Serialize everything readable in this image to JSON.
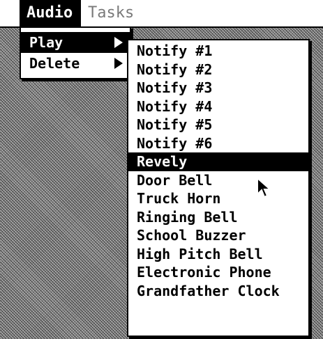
{
  "menubar": {
    "items": [
      {
        "label": "Audio",
        "state": "open"
      },
      {
        "label": "Tasks",
        "state": "inactive"
      }
    ]
  },
  "audio_menu": {
    "items": [
      {
        "label": "Play",
        "submenu": true,
        "selected": true
      },
      {
        "label": "Delete",
        "submenu": true,
        "selected": false
      }
    ]
  },
  "play_submenu": {
    "highlighted": "Revely",
    "items": [
      "Notify #1",
      "Notify #2",
      "Notify #3",
      "Notify #4",
      "Notify #5",
      "Notify #6",
      "Revely",
      "Door Bell",
      "Truck Horn",
      "Ringing Bell",
      "School Buzzer",
      "High Pitch Bell",
      "Electronic Phone",
      "Grandfather Clock"
    ]
  },
  "icons": {
    "submenu_arrow": "chevron-right-icon",
    "cursor": "pointer-arrow-icon"
  },
  "colors": {
    "menu_bg": "#ffffff",
    "highlight_bg": "#000000",
    "highlight_text": "#ffffff",
    "inactive_text": "#7a7a7a"
  }
}
